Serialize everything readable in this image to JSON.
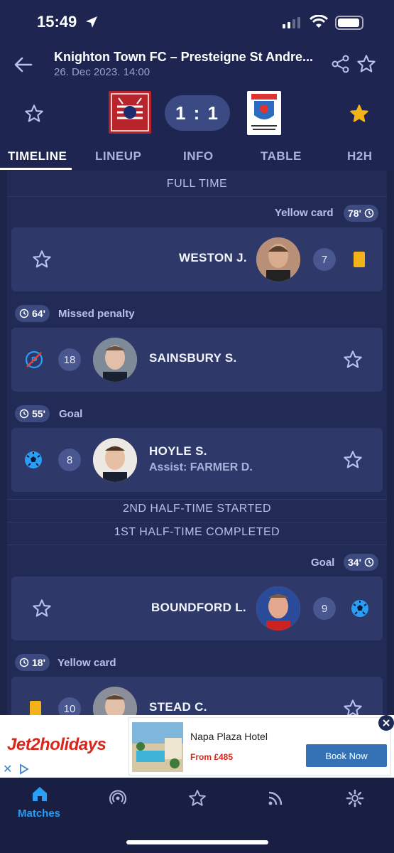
{
  "status": {
    "time": "15:49"
  },
  "header": {
    "title": "Knighton Town FC – Presteigne St Andre...",
    "subtitle": "26. Dec 2023. 14:00"
  },
  "score": {
    "text": "1 : 1"
  },
  "tabs": [
    {
      "label": "TIMELINE"
    },
    {
      "label": "LINEUP"
    },
    {
      "label": "INFO"
    },
    {
      "label": "TABLE"
    },
    {
      "label": "H2H"
    }
  ],
  "timeline": {
    "full_time": "FULL TIME",
    "e1": {
      "type": "Yellow card",
      "minute": "78'",
      "player": "WESTON J.",
      "number": "7"
    },
    "e2": {
      "type": "Missed penalty",
      "minute": "64'",
      "player": "SAINSBURY S.",
      "number": "18"
    },
    "e3": {
      "type": "Goal",
      "minute": "55'",
      "player": "HOYLE S.",
      "number": "8",
      "assist": "Assist: FARMER D."
    },
    "second_half": "2ND HALF-TIME STARTED",
    "first_half_done": "1ST HALF-TIME COMPLETED",
    "e4": {
      "type": "Goal",
      "minute": "34'",
      "player": "BOUNDFORD L.",
      "number": "9"
    },
    "e5": {
      "type": "Yellow card",
      "minute": "18'",
      "player": "STEAD C.",
      "number": "10"
    }
  },
  "ad": {
    "brand": "Jet2holidays",
    "hotel": "Napa Plaza Hotel",
    "price": "From £485",
    "cta": "Book Now"
  },
  "nav": {
    "matches": "Matches"
  },
  "colors": {
    "background": "#1c2448",
    "card": "#2e3969",
    "accent": "#2a9df4",
    "yellow": "#f2b31a"
  }
}
